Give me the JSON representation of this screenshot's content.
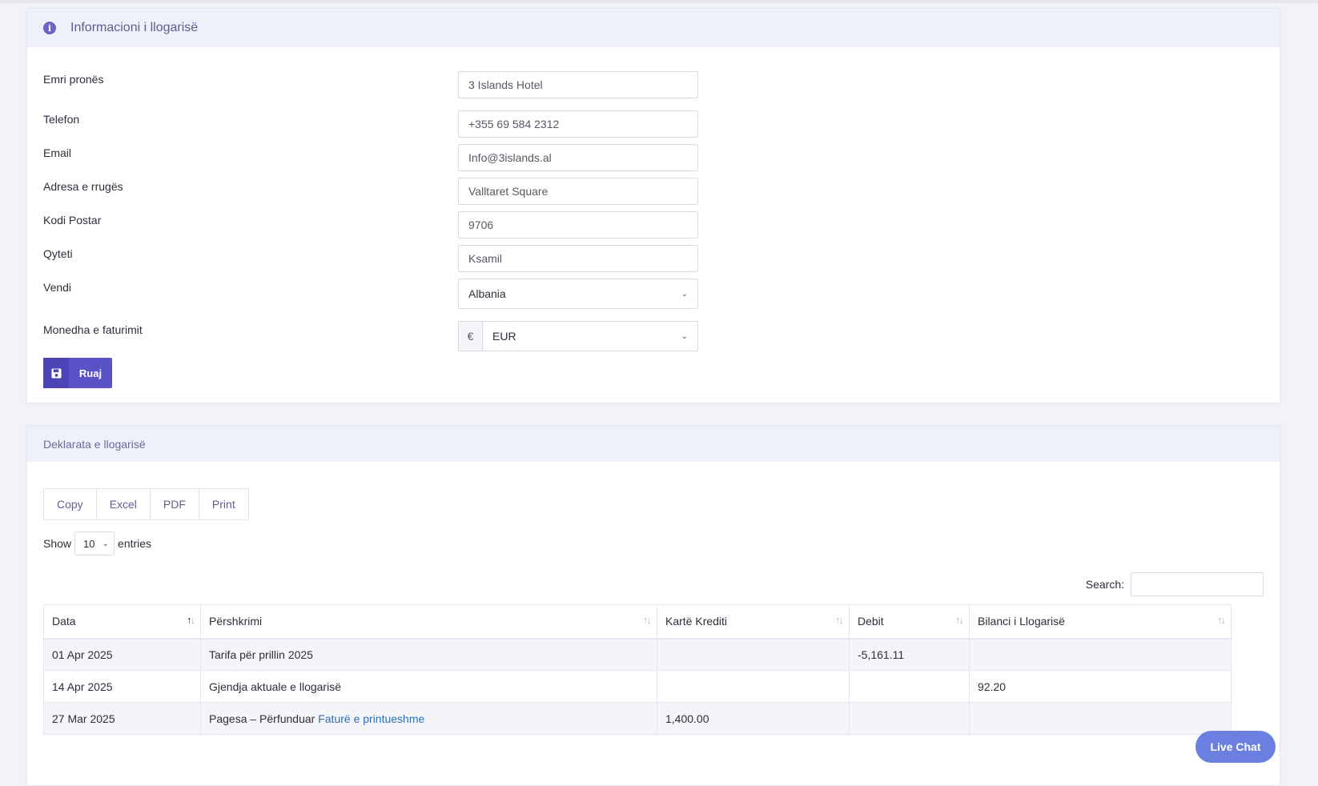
{
  "account_info": {
    "title": "Informacioni i llogarisë",
    "fields": [
      {
        "label": "Emri pronës",
        "value": "3 Islands Hotel"
      },
      {
        "label": "Telefon",
        "value": "+355 69 584 2312"
      },
      {
        "label": "Email",
        "value": "Info@3islands.al"
      },
      {
        "label": "Adresa e rrugës",
        "value": "Valltaret Square"
      },
      {
        "label": "Kodi Postar",
        "value": "9706"
      },
      {
        "label": "Qyteti",
        "value": "Ksamil"
      }
    ],
    "country": {
      "label": "Vendi",
      "value": "Albania"
    },
    "currency": {
      "label": "Monedha e faturimit",
      "symbol": "€",
      "value": "EUR"
    },
    "save_label": "Ruaj"
  },
  "statement": {
    "title": "Deklarata e llogarisë",
    "export_buttons": [
      "Copy",
      "Excel",
      "PDF",
      "Print"
    ],
    "show_label": "Show",
    "page_length": "10",
    "entries_label": "entries",
    "search_label": "Search:",
    "columns": [
      "Data",
      "Përshkrimi",
      "Kartë Krediti",
      "Debit",
      "Bilanci i Llogarisë"
    ],
    "rows": [
      {
        "date": "01 Apr 2025",
        "description": "Tarifa për prillin 2025",
        "link": "",
        "credit": "",
        "debit": "-5,161.11",
        "balance": ""
      },
      {
        "date": "14 Apr 2025",
        "description": "Gjendja aktuale e llogarisë",
        "link": "",
        "credit": "",
        "debit": "",
        "balance": "92.20"
      },
      {
        "date": "27 Mar 2025",
        "description": "Pagesa – Përfunduar",
        "link": "Faturë e printueshme",
        "credit": "1,400.00",
        "debit": "",
        "balance": ""
      }
    ]
  },
  "live_chat_label": "Live Chat",
  "colors": {
    "accent": "#5b52c7",
    "header_bg": "#eef0fa",
    "link": "#2c6fb7",
    "chat": "#6b7fe0"
  }
}
